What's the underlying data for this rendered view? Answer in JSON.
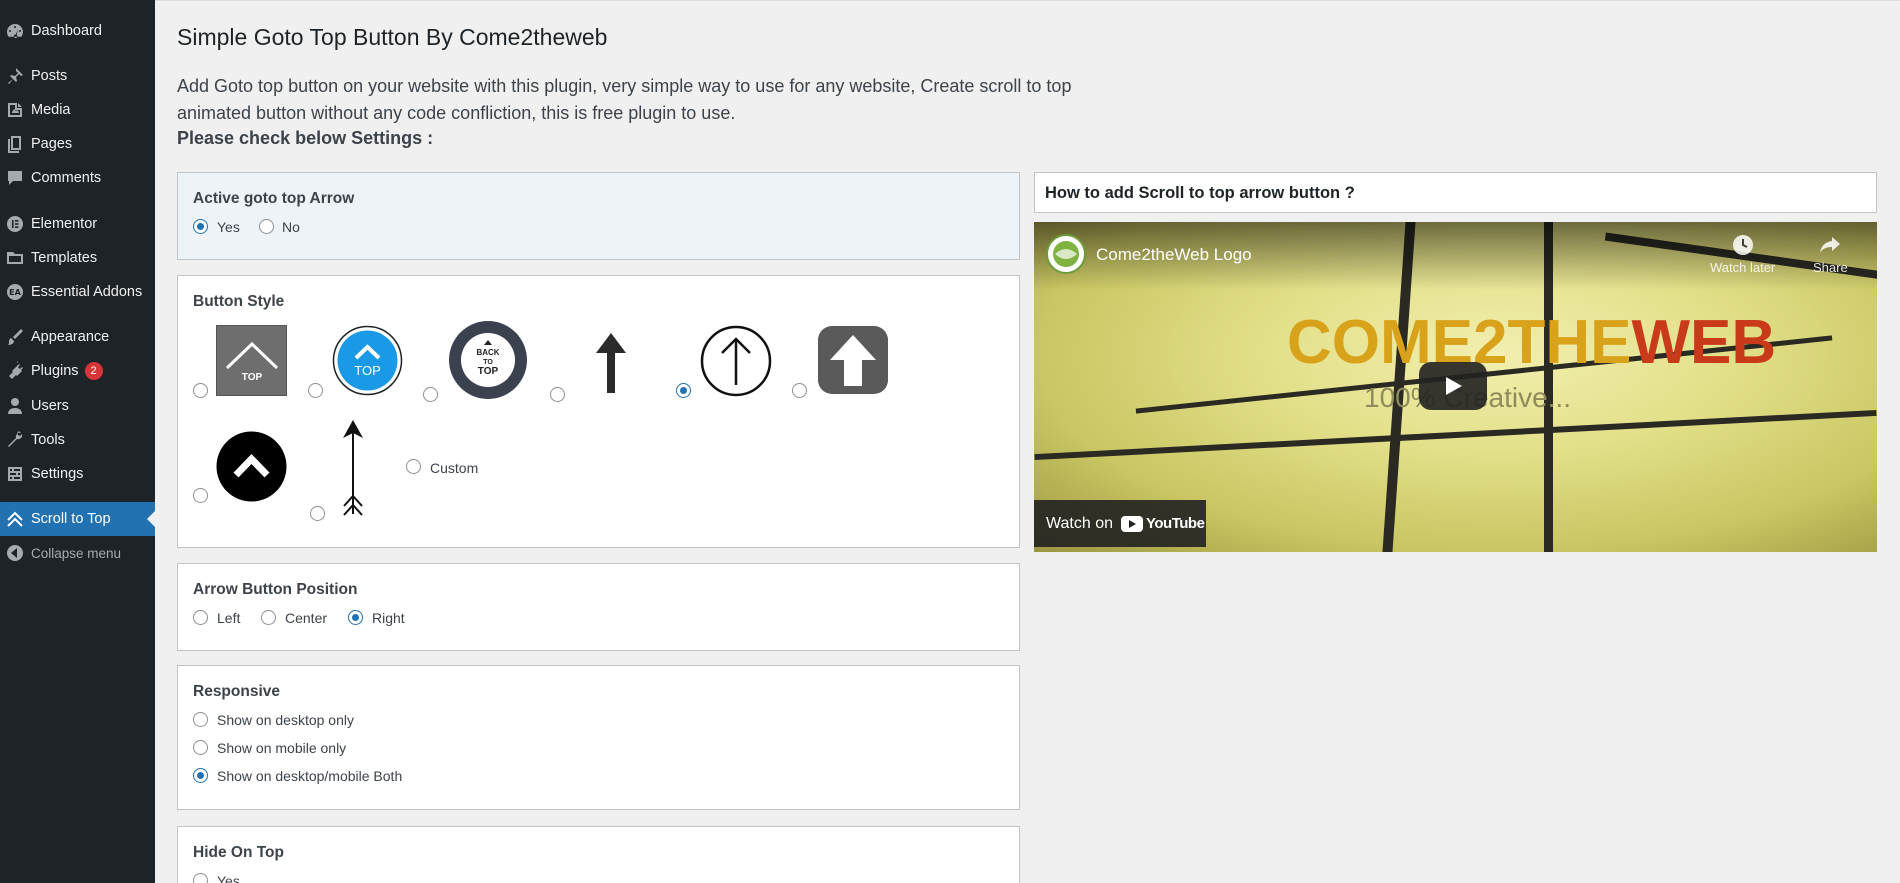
{
  "sidebar": {
    "items": [
      {
        "label": "Dashboard",
        "icon": "dashboard-icon"
      },
      {
        "label": "Posts",
        "icon": "pushpin-icon"
      },
      {
        "label": "Media",
        "icon": "media-icon"
      },
      {
        "label": "Pages",
        "icon": "pages-icon"
      },
      {
        "label": "Comments",
        "icon": "comment-icon"
      },
      {
        "label": "Elementor",
        "icon": "elementor-icon"
      },
      {
        "label": "Templates",
        "icon": "folder-icon"
      },
      {
        "label": "Essential Addons",
        "icon": "ea-icon"
      },
      {
        "label": "Appearance",
        "icon": "brush-icon"
      },
      {
        "label": "Plugins",
        "icon": "plug-icon",
        "badge": "2"
      },
      {
        "label": "Users",
        "icon": "user-icon"
      },
      {
        "label": "Tools",
        "icon": "wrench-icon"
      },
      {
        "label": "Settings",
        "icon": "settings-icon"
      },
      {
        "label": "Scroll to Top",
        "icon": "chevrons-up-icon",
        "current": true
      },
      {
        "label": "Collapse menu",
        "icon": "collapse-icon"
      }
    ]
  },
  "page": {
    "title": "Simple Goto Top Button By Come2theweb",
    "description": "Add Goto top button on your website with this plugin, very simple way to use for any website, Create scroll to top animated button without any code confliction, this is free plugin to use.",
    "note": "Please check below Settings :"
  },
  "settings": {
    "active_arrow": {
      "title": "Active goto top Arrow",
      "options": [
        "Yes",
        "No"
      ],
      "selected": "Yes"
    },
    "button_style": {
      "title": "Button Style",
      "styles": [
        "gray-square-top",
        "blue-circle-top",
        "back-to-top-badge",
        "thin-arrow",
        "circle-arrow",
        "rounded-up-arrow",
        "black-circle-chevron",
        "long-arrow",
        "custom"
      ],
      "custom_label": "Custom",
      "selected": "circle-arrow",
      "icon_texts": {
        "top": "TOP",
        "blue_top": "TOP",
        "badge_line1": "BACK",
        "badge_line2": "TO",
        "badge_line3": "TOP"
      }
    },
    "position": {
      "title": "Arrow Button Position",
      "options": [
        "Left",
        "Center",
        "Right"
      ],
      "selected": "Right"
    },
    "responsive": {
      "title": "Responsive",
      "options": [
        "Show on desktop only",
        "Show on mobile only",
        "Show on desktop/mobile Both"
      ],
      "selected": "Show on desktop/mobile Both"
    },
    "hide_on_top": {
      "title": "Hide On Top",
      "options": [
        "Yes"
      ]
    }
  },
  "video": {
    "heading": "How to add Scroll to top arrow button ?",
    "channel_name": "Come2theWeb Logo",
    "watch_later": "Watch later",
    "share": "Share",
    "brand_part1": "COME2THE",
    "brand_part2": "WEB",
    "tagline": "100% Creative...",
    "watch_on": "Watch on",
    "youtube": "YouTube"
  },
  "colors": {
    "sidebar_bg": "#1d2327",
    "accent": "#2271b1",
    "badge": "#d63638",
    "style_blue": "#1a9ae6"
  }
}
